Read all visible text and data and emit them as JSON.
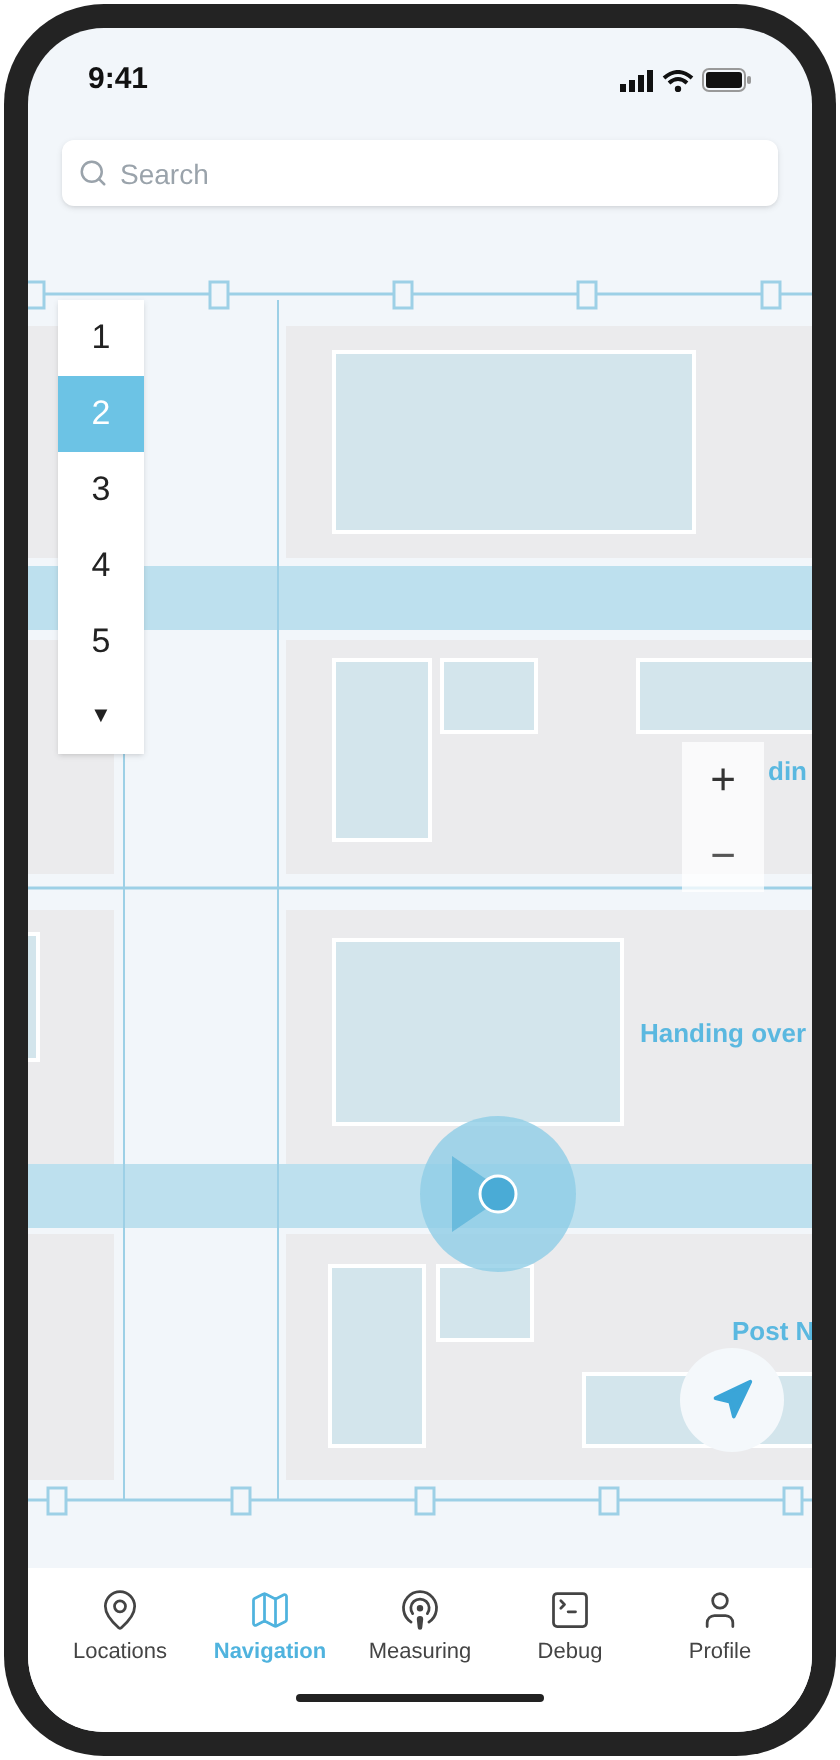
{
  "status_bar": {
    "time": "9:41"
  },
  "search": {
    "placeholder": "Search"
  },
  "floors": {
    "items": [
      {
        "label": "1",
        "selected": false
      },
      {
        "label": "2",
        "selected": true
      },
      {
        "label": "3",
        "selected": false
      },
      {
        "label": "4",
        "selected": false
      },
      {
        "label": "5",
        "selected": false
      }
    ],
    "more": "▼"
  },
  "map_labels": [
    {
      "text": "din"
    },
    {
      "text": "Handing over"
    },
    {
      "text": "Post N"
    }
  ],
  "zoom": {
    "plus": "+",
    "minus": "−"
  },
  "tabs": [
    {
      "label": "Locations",
      "selected": false
    },
    {
      "label": "Navigation",
      "selected": true
    },
    {
      "label": "Measuring",
      "selected": false
    },
    {
      "label": "Debug",
      "selected": false
    },
    {
      "label": "Profile",
      "selected": false
    }
  ]
}
